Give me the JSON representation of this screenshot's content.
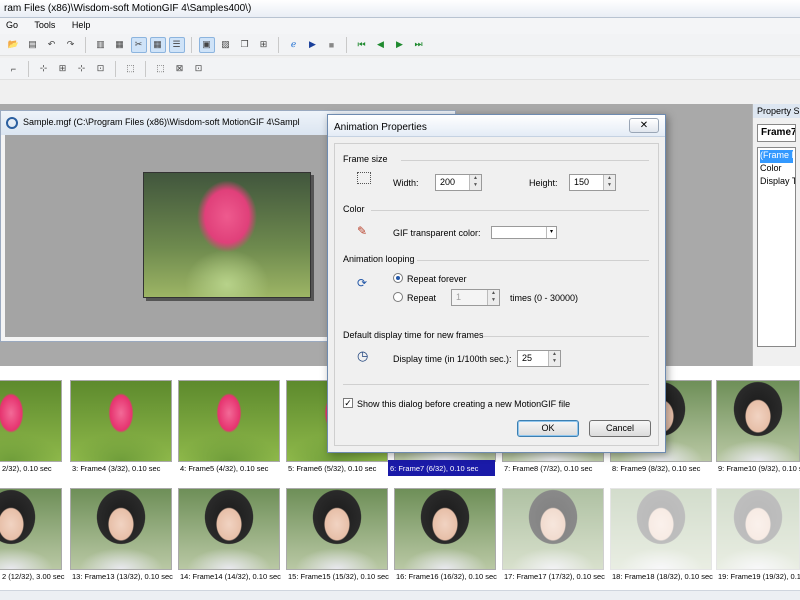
{
  "window": {
    "title": "ram Files (x86)\\Wisdom-soft MotionGIF 4\\Samples400\\)"
  },
  "menu": {
    "items": [
      "Go",
      "Tools",
      "Help"
    ]
  },
  "document": {
    "title": "Sample.mgf (C:\\Program Files (x86)\\Wisdom-soft MotionGIF 4\\Sampl"
  },
  "property_panel": {
    "header": "Property Sh",
    "selector": "Frame7",
    "rows": [
      "(Frame Na",
      "Color",
      "Display Ti"
    ]
  },
  "dialog": {
    "title": "Animation Properties",
    "close_label": "✕",
    "frame_size": {
      "heading": "Frame size",
      "width_label": "Width:",
      "width_value": "200",
      "height_label": "Height:",
      "height_value": "150"
    },
    "color": {
      "heading": "Color",
      "transparent_label": "GIF transparent color:"
    },
    "looping": {
      "heading": "Animation looping",
      "forever_label": "Repeat forever",
      "repeat_label": "Repeat",
      "repeat_value": "1",
      "times_label": "times  (0 - 30000)",
      "selected": "forever"
    },
    "display_time": {
      "heading": "Default display time for new frames",
      "label": "Display time (in 1/100th sec.):",
      "value": "25"
    },
    "show_dialog_label": "Show this dialog before creating a new MotionGIF file",
    "show_dialog_checked": true,
    "ok_label": "OK",
    "cancel_label": "Cancel"
  },
  "frames_row1": [
    "2/32), 0.10 sec",
    "3: Frame4 (3/32), 0.10 sec",
    "4: Frame5 (4/32), 0.10 sec",
    "5: Frame6 (5/32), 0.10 sec",
    "6: Frame7 (6/32), 0.10 sec",
    "7: Frame8 (7/32), 0.10 sec",
    "8: Frame9 (8/32), 0.10 sec",
    "9: Frame10 (9/32), 0.10 sec"
  ],
  "frames_row2": [
    "2 (12/32), 3.00 sec",
    "13: Frame13 (13/32), 0.10 sec",
    "14: Frame14 (14/32), 0.10 sec",
    "15: Frame15 (15/32), 0.10 sec",
    "16: Frame16 (16/32), 0.10 sec",
    "17: Frame17 (17/32), 0.10 sec",
    "18: Frame18 (18/32), 0.10 sec",
    "19: Frame19 (19/32), 0.10 sec"
  ],
  "selected_frame_index": 4,
  "colors": {
    "selection": "#1a1aa8",
    "accent": "#3399ff"
  }
}
